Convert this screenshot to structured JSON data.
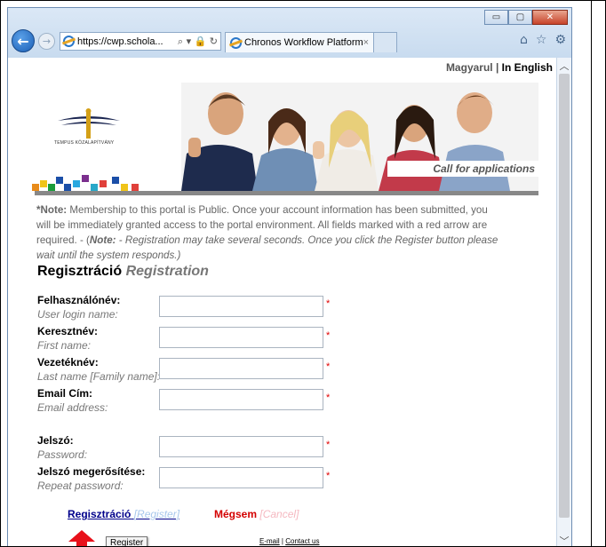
{
  "browser": {
    "address_url": "https://cwp.schola...",
    "address_tools": "⌕ ▾ 🔒 ↻",
    "tab_title": "Chronos Workflow Platform",
    "tab_close": "×",
    "window_min": "▭",
    "window_max": "▢",
    "window_close": "✕",
    "back_glyph": "←",
    "forward_glyph": "→"
  },
  "lang": {
    "hungarian": "Magyarul",
    "separator": " | ",
    "english": "In English"
  },
  "logo": {
    "text": "TEMPUS KÖZALAPÍTVÁNY"
  },
  "banner": {
    "caption": "Call for applications"
  },
  "note": {
    "prefix": "*Note:",
    "body": " Membership to this portal is Public. Once your account information has been submitted, you will be immediately granted access to the portal environment. All fields marked with a red arrow are required. - (",
    "note2_label": "Note:",
    "note2_body": " - Registration may take several seconds. Once you click the Register button please wait until the system responds.)"
  },
  "form": {
    "title_hu": "Regisztráció",
    "title_en": "Registration",
    "fields": [
      {
        "label": "Felhasználónév:",
        "sub": "User login name:"
      },
      {
        "label": "Keresztnév:",
        "sub": "First name:"
      },
      {
        "label": "Vezetéknév:",
        "sub": "Last name [Family name]:"
      },
      {
        "label": "Email Cím:",
        "sub": "Email address:"
      },
      {
        "label": "Jelszó:",
        "sub": "Password:"
      },
      {
        "label": "Jelszó megerősítése:",
        "sub": "Repeat password:"
      }
    ],
    "required_mark": "*"
  },
  "actions": {
    "register_hu": "Regisztráció",
    "register_en": "[Register]",
    "cancel_hu": "Mégsem",
    "cancel_en": "[Cancel]",
    "tooltip": "Register"
  },
  "footer": {
    "email": "E-mail",
    "sep": "|",
    "contact": "Contact us"
  },
  "colors": {
    "accent_blue": "#00008b",
    "cancel_red": "#d40000",
    "required_red": "#e00000",
    "arrow_red": "#e8101a"
  }
}
